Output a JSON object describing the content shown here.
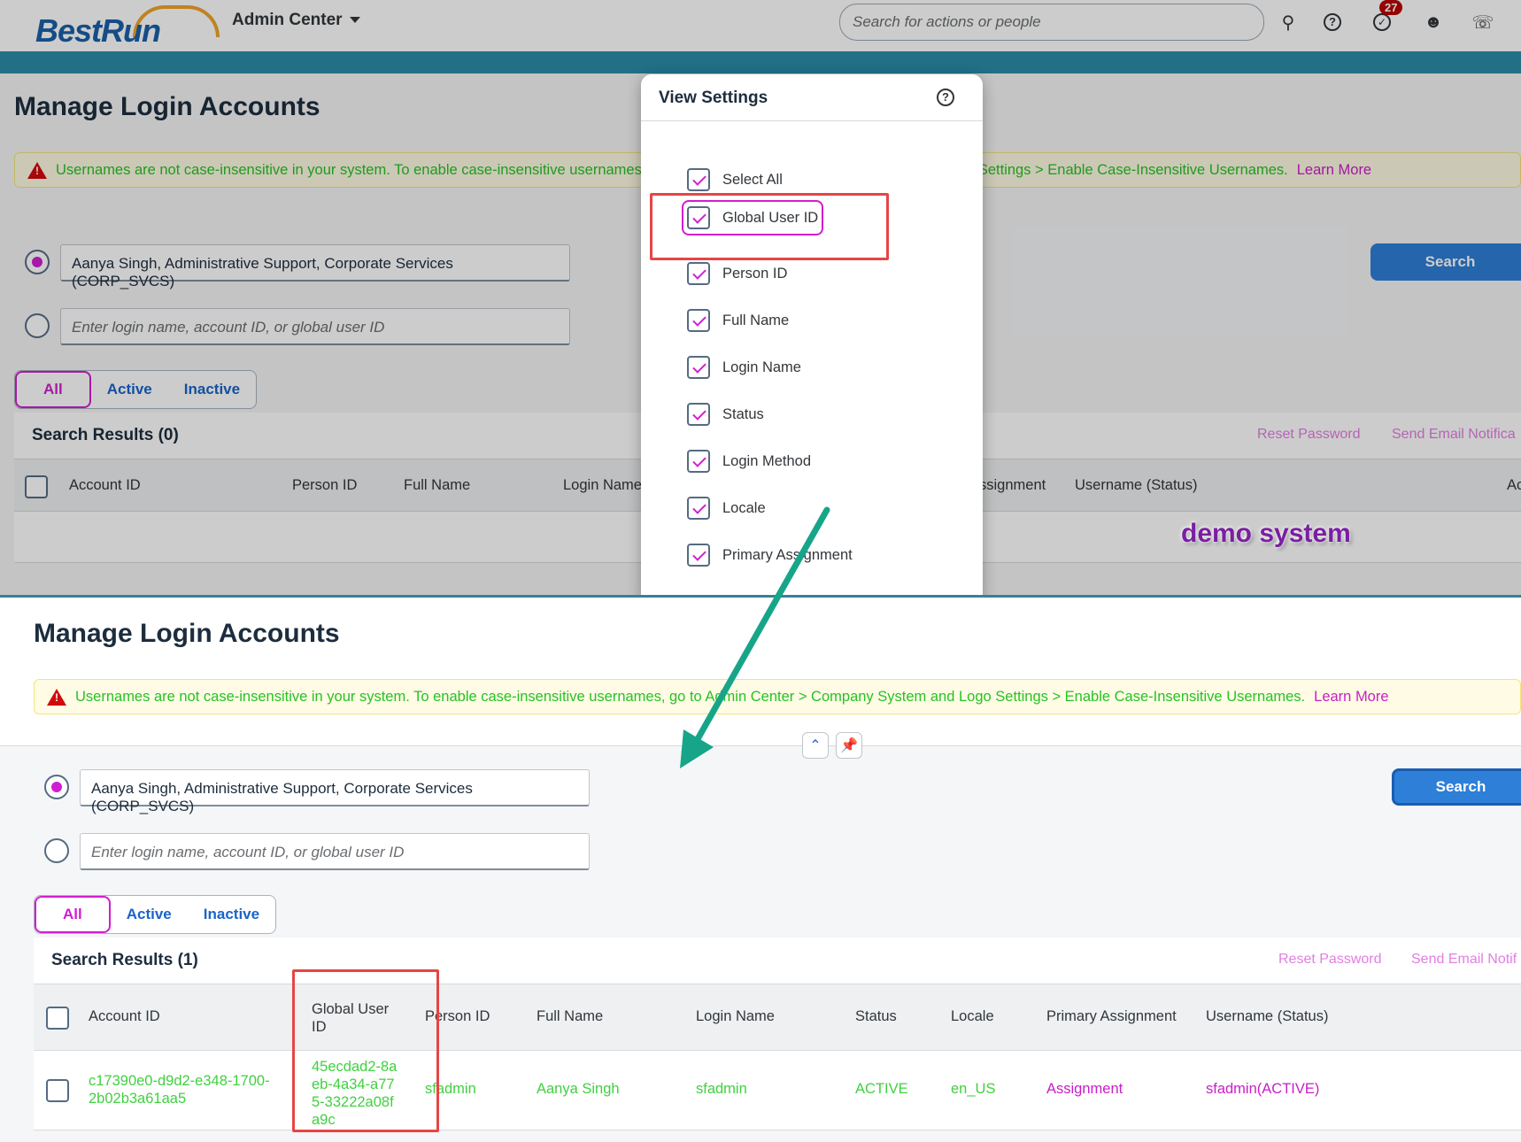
{
  "shell": {
    "logo": "BestRun",
    "menu_label": "Admin Center",
    "search_placeholder": "Search for actions or people",
    "notification_count": "27"
  },
  "top": {
    "page_title": "Manage Login Accounts",
    "warning_text": "Usernames are not case-insensitive in your system. To enable case-insensitive usernames",
    "warning_text_tail": "Settings > Enable Case-Insensitive Usernames.",
    "learn_more": "Learn More",
    "selected_user": "Aanya Singh, Administrative Support, Corporate Services (CORP_SVCS)",
    "login_placeholder": "Enter login name, account ID, or global user ID",
    "search_button": "Search",
    "filters": [
      "All",
      "Active",
      "Inactive"
    ],
    "results_title": "Search Results (0)",
    "actions": [
      "Reset Password",
      "Send Email Notifica"
    ],
    "columns": [
      "Account ID",
      "Person ID",
      "Full Name",
      "Login Name",
      "ssignment",
      "Username (Status)",
      "Ac"
    ],
    "watermark": "demo system"
  },
  "dialog": {
    "title": "View Settings",
    "options": [
      "Select All",
      "Global User ID",
      "Person ID",
      "Full Name",
      "Login Name",
      "Status",
      "Login Method",
      "Locale",
      "Primary Assignment"
    ]
  },
  "bottom": {
    "page_title": "Manage Login Accounts",
    "warning_text": "Usernames are not case-insensitive in your system. To enable case-insensitive usernames, go to Admin Center > Company System and Logo Settings > Enable Case-Insensitive Usernames.",
    "learn_more": "Learn More",
    "selected_user": "Aanya Singh, Administrative Support, Corporate Services (CORP_SVCS)",
    "login_placeholder": "Enter login name, account ID, or global user ID",
    "search_button": "Search",
    "filters": [
      "All",
      "Active",
      "Inactive"
    ],
    "results_title": "Search Results (1)",
    "actions": [
      "Reset Password",
      "Send Email Notif"
    ],
    "columns": [
      "Account ID",
      "Global User ID",
      "Person ID",
      "Full Name",
      "Login Name",
      "Status",
      "Locale",
      "Primary Assignment",
      "Username (Status)"
    ],
    "row": {
      "account_id": "c17390e0-d9d2-e348-1700-2b02b3a61aa5",
      "global_user_id": "45ecdad2-8aeb-4a34-a775-33222a08fa9c",
      "person_id": "sfadmin",
      "full_name": "Aanya Singh",
      "login_name": "sfadmin",
      "status": "ACTIVE",
      "locale": "en_US",
      "primary_assignment": "Assignment",
      "username_status": "sfadmin(ACTIVE)"
    }
  },
  "colors": {
    "accent": "#d11ed1",
    "link_green": "#27c227",
    "button_blue": "#2d7fd8",
    "annotation_red": "#e64545",
    "arrow": "#17a589"
  }
}
